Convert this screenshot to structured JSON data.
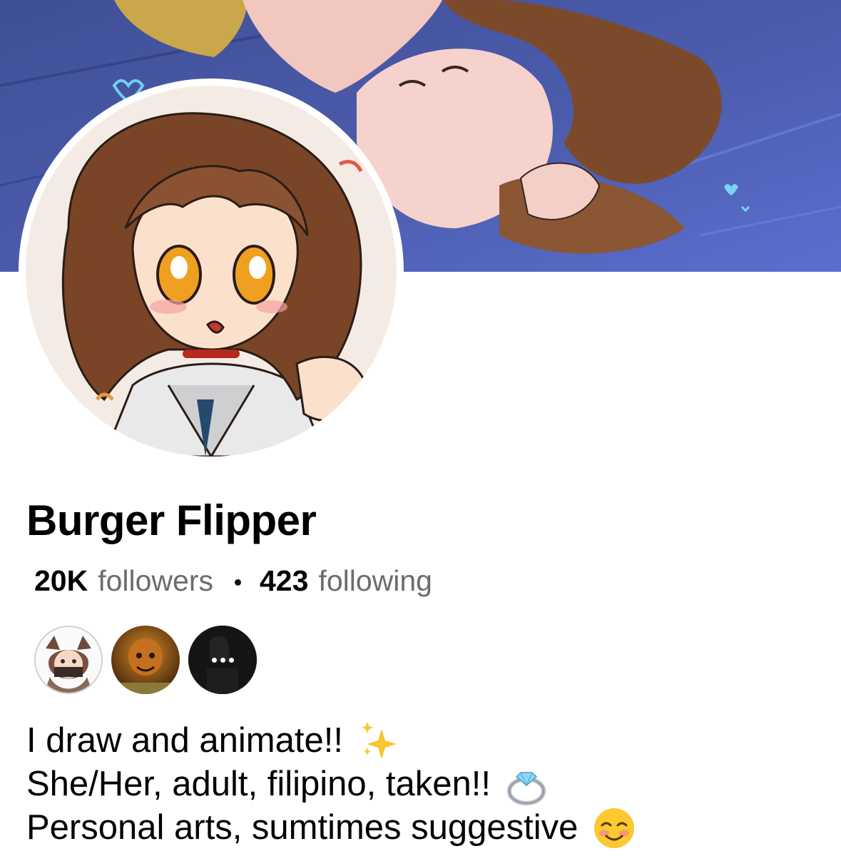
{
  "profile": {
    "name": "Burger Flipper",
    "followers_count": "20K",
    "followers_label": "followers",
    "following_count": "423",
    "following_label": "following"
  },
  "mutuals": [
    {
      "name": "mutual-follower-avatar-1"
    },
    {
      "name": "mutual-follower-avatar-2"
    },
    {
      "name": "more-mutuals",
      "icon": "more-dots-icon"
    }
  ],
  "bio": {
    "lines": [
      {
        "text": "I draw and animate!!",
        "emoji": "sparkles-emoji"
      },
      {
        "text": "She/Her, adult, filipino, taken!!",
        "emoji": "ring-emoji"
      },
      {
        "text": "Personal arts, sumtimes suggestive",
        "emoji": "smiling-face-emoji"
      }
    ]
  },
  "colors": {
    "cover_background": "#4a5aa8",
    "name_text": "#000000",
    "secondary_text": "#6b6b70",
    "page_background": "#ffffff"
  }
}
